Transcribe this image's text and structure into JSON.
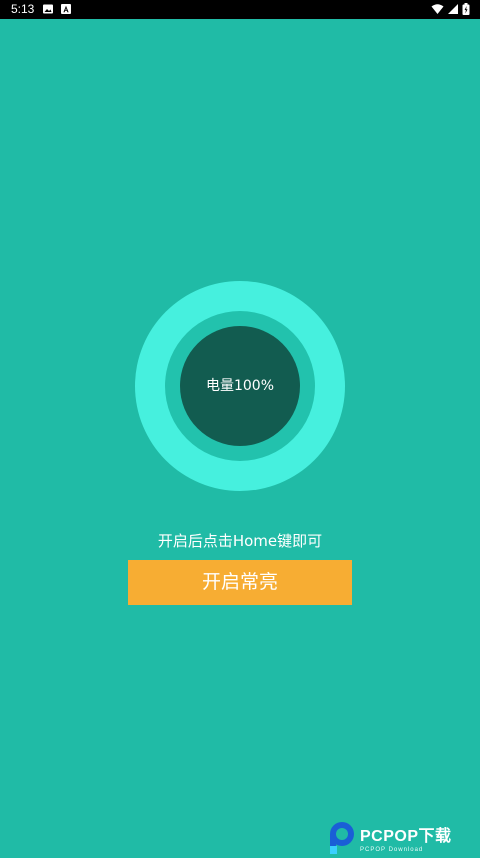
{
  "status_bar": {
    "time": "5:13",
    "icons": [
      "image-icon",
      "a-letter-icon",
      "wifi-icon",
      "signal-icon",
      "battery-icon"
    ]
  },
  "gauge": {
    "label": "电量100%"
  },
  "hint": {
    "text": "开启后点击Home键即可"
  },
  "action": {
    "label": "开启常亮"
  },
  "watermark": {
    "text": "PCPOP下载",
    "subtext": "PCPOP Download"
  },
  "colors": {
    "background": "#20bba6",
    "gauge_outer": "#46f0de",
    "gauge_mid": "#22c2ad",
    "gauge_inner": "#125c50",
    "button": "#f7ad33",
    "status_bar": "#000000"
  }
}
